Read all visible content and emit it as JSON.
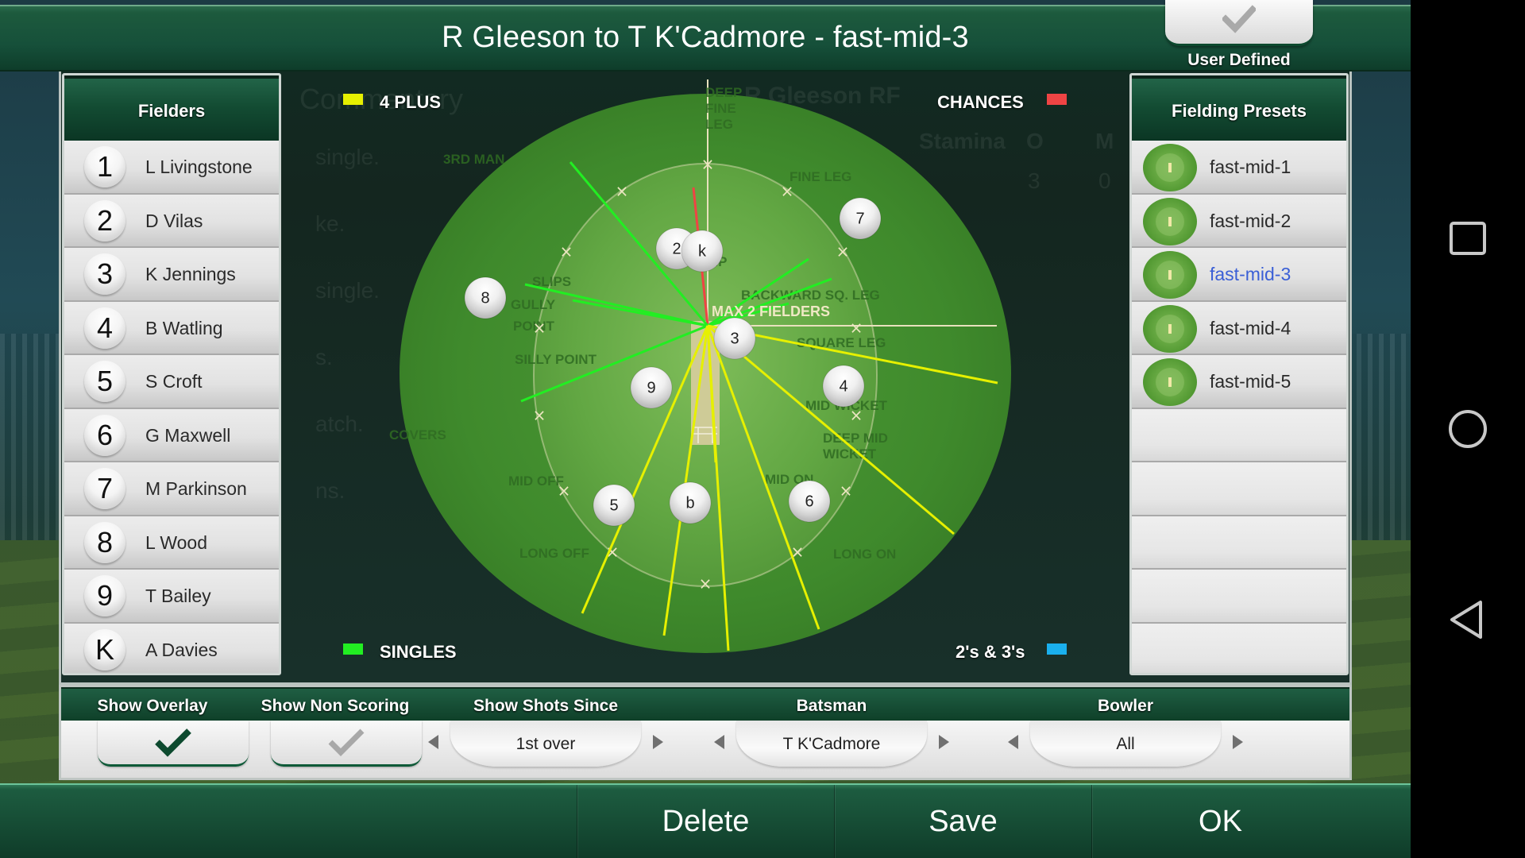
{
  "header": {
    "title": "R Gleeson to T K'Cadmore - fast-mid-3",
    "user_defined_label": "User Defined",
    "user_defined_checked": false
  },
  "fielders_panel": {
    "title": "Fielders",
    "items": [
      {
        "badge": "1",
        "name": "L Livingstone"
      },
      {
        "badge": "2",
        "name": "D Vilas"
      },
      {
        "badge": "3",
        "name": "K Jennings"
      },
      {
        "badge": "4",
        "name": "B Watling"
      },
      {
        "badge": "5",
        "name": "S Croft"
      },
      {
        "badge": "6",
        "name": "G Maxwell"
      },
      {
        "badge": "7",
        "name": "M Parkinson"
      },
      {
        "badge": "8",
        "name": "L Wood"
      },
      {
        "badge": "9",
        "name": "T Bailey"
      },
      {
        "badge": "K",
        "name": "A Davies"
      }
    ]
  },
  "presets_panel": {
    "title": "Fielding Presets",
    "items": [
      {
        "name": "fast-mid-1",
        "selected": false
      },
      {
        "name": "fast-mid-2",
        "selected": false
      },
      {
        "name": "fast-mid-3",
        "selected": true
      },
      {
        "name": "fast-mid-4",
        "selected": false
      },
      {
        "name": "fast-mid-5",
        "selected": false
      }
    ],
    "empty_rows": 5
  },
  "background_text": {
    "commentary_title": "Commentary",
    "commentary_lines": [
      "single.",
      "ke.",
      "single.",
      "s.",
      "atch.",
      "ns."
    ],
    "bowler_name": "R Gleeson RF",
    "stat_headers": [
      "Stamina",
      "O",
      "M"
    ],
    "stat_values": [
      "3",
      "0"
    ]
  },
  "legend": {
    "four_plus": {
      "label": "4 PLUS",
      "color": "#e6f000"
    },
    "chances": {
      "label": "CHANCES",
      "color": "#ef4444"
    },
    "singles": {
      "label": "SINGLES",
      "color": "#22ee22"
    },
    "twos_threes": {
      "label": "2's & 3's",
      "color": "#1ab0ee"
    }
  },
  "field": {
    "restriction_label": "MAX 2 FIELDERS",
    "zone_labels": [
      {
        "text": "DEEP",
        "k": "dfl1"
      },
      {
        "text": "FINE",
        "k": "dfl2"
      },
      {
        "text": "LEG",
        "k": "dfl3"
      },
      {
        "text": "3RD MAN",
        "k": "3rd"
      },
      {
        "text": "FINE LEG",
        "k": "fl"
      },
      {
        "text": "LEG SLIP",
        "k": "ls"
      },
      {
        "text": "SLIPS",
        "k": "slips"
      },
      {
        "text": "GULLY",
        "k": "gully"
      },
      {
        "text": "POINT",
        "k": "point"
      },
      {
        "text": "BACKWARD SQ. LEG",
        "k": "bsl"
      },
      {
        "text": "SQUARE LEG",
        "k": "sl"
      },
      {
        "text": "SILLY POINT",
        "k": "sp"
      },
      {
        "text": "MID WICKET",
        "k": "mw"
      },
      {
        "text": "COVERS",
        "k": "cov"
      },
      {
        "text": "DEEP MID",
        "k": "dmw1"
      },
      {
        "text": "WICKET",
        "k": "dmw2"
      },
      {
        "text": "MID OFF",
        "k": "mo"
      },
      {
        "text": "MID ON",
        "k": "mon"
      },
      {
        "text": "LONG OFF",
        "k": "lo"
      },
      {
        "text": "LONG ON",
        "k": "lon"
      }
    ],
    "players": [
      {
        "label": "8",
        "k": "p8"
      },
      {
        "label": "2",
        "k": "p2"
      },
      {
        "label": "k",
        "k": "pk"
      },
      {
        "label": "7",
        "k": "p7"
      },
      {
        "label": "3",
        "k": "p3"
      },
      {
        "label": "9",
        "k": "p9"
      },
      {
        "label": "4",
        "k": "p4"
      },
      {
        "label": "5",
        "k": "p5"
      },
      {
        "label": "b",
        "k": "pb"
      },
      {
        "label": "6",
        "k": "p6"
      }
    ],
    "shots": [
      {
        "type": "chances",
        "k": "s1"
      },
      {
        "type": "singles",
        "k": "s2"
      },
      {
        "type": "singles",
        "k": "s3"
      },
      {
        "type": "singles",
        "k": "s4"
      },
      {
        "type": "singles",
        "k": "s5"
      },
      {
        "type": "singles",
        "k": "s6"
      },
      {
        "type": "singles",
        "k": "s7"
      },
      {
        "type": "singles",
        "k": "s8"
      },
      {
        "type": "four_plus",
        "k": "s9"
      },
      {
        "type": "four_plus",
        "k": "s10"
      },
      {
        "type": "four_plus",
        "k": "s11"
      },
      {
        "type": "four_plus",
        "k": "s12"
      },
      {
        "type": "four_plus",
        "k": "s13"
      },
      {
        "type": "four_plus",
        "k": "s14"
      },
      {
        "type": "four_plus",
        "k": "s15"
      }
    ]
  },
  "controls": {
    "show_overlay": {
      "label": "Show Overlay",
      "checked": true
    },
    "show_non_scoring": {
      "label": "Show Non Scoring",
      "checked": false
    },
    "show_shots_since": {
      "label": "Show Shots Since",
      "value": "1st over"
    },
    "batsman": {
      "label": "Batsman",
      "value": "T K'Cadmore"
    },
    "bowler": {
      "label": "Bowler",
      "value": "All"
    }
  },
  "actions": {
    "delete": "Delete",
    "save": "Save",
    "ok": "OK"
  },
  "android_nav": {
    "recents": "recents",
    "home": "home",
    "back": "back"
  }
}
